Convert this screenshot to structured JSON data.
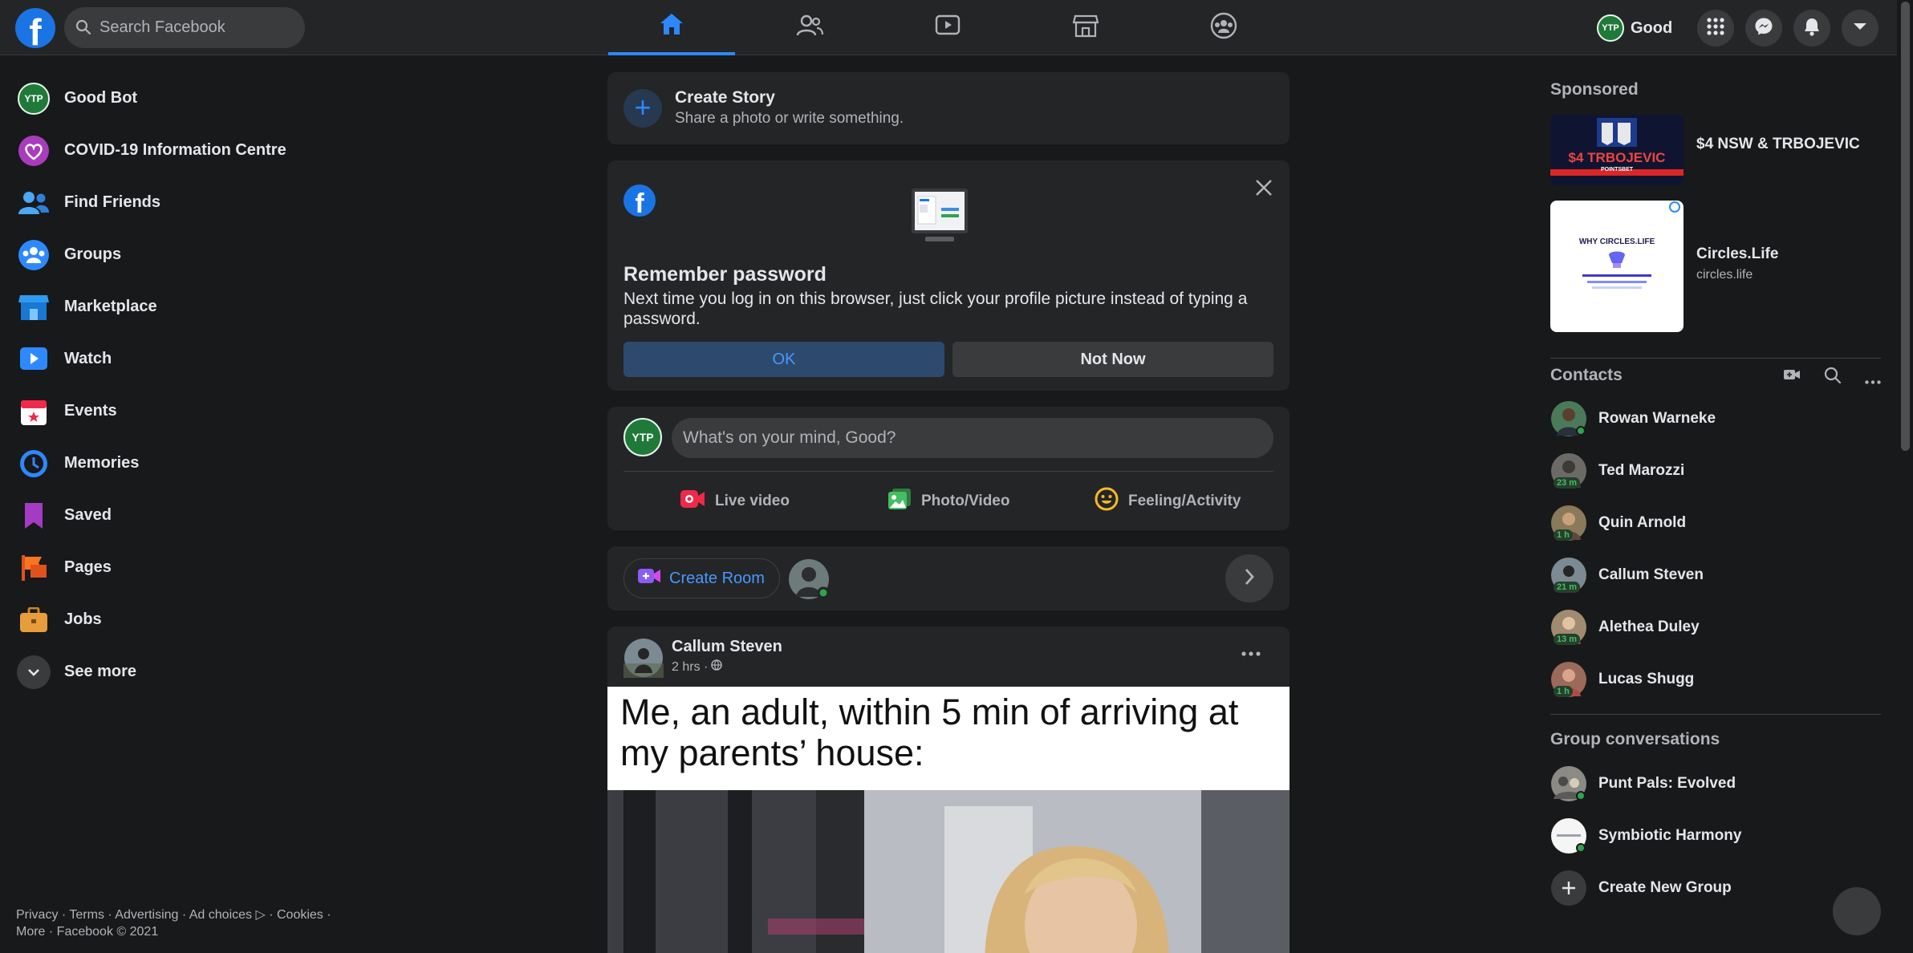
{
  "header": {
    "logo": "f",
    "search_placeholder": "Search Facebook",
    "nav_tabs": [
      {
        "name": "home",
        "icon": "home-icon",
        "active": true
      },
      {
        "name": "friends",
        "icon": "friends-icon",
        "active": false
      },
      {
        "name": "watch",
        "icon": "watch-icon",
        "active": false
      },
      {
        "name": "marketplace",
        "icon": "marketplace-icon",
        "active": false
      },
      {
        "name": "groups",
        "icon": "groups-icon",
        "active": false
      }
    ],
    "profile_badge": "YTP",
    "profile_name": "Good",
    "action_icons": [
      "menu-grid-icon",
      "messenger-icon",
      "notifications-icon",
      "account-dropdown-icon"
    ]
  },
  "sidebar": {
    "items": [
      {
        "label": "Good Bot",
        "icon": "profile-avatar"
      },
      {
        "label": "COVID-19 Information Centre",
        "icon": "covid-heart-icon"
      },
      {
        "label": "Find Friends",
        "icon": "friends-icon"
      },
      {
        "label": "Groups",
        "icon": "groups-icon"
      },
      {
        "label": "Marketplace",
        "icon": "marketplace-icon"
      },
      {
        "label": "Watch",
        "icon": "watch-icon"
      },
      {
        "label": "Events",
        "icon": "calendar-icon"
      },
      {
        "label": "Memories",
        "icon": "clock-icon"
      },
      {
        "label": "Saved",
        "icon": "bookmark-icon"
      },
      {
        "label": "Pages",
        "icon": "flag-icon"
      },
      {
        "label": "Jobs",
        "icon": "briefcase-icon"
      },
      {
        "label": "See more",
        "icon": "chevron-down-icon"
      }
    ],
    "footer_line1": "Privacy · Terms · Advertising · Ad choices ▷ · Cookies ·",
    "footer_line2": "More · Facebook © 2021"
  },
  "feed": {
    "story": {
      "title": "Create Story",
      "subtitle": "Share a photo or write something."
    },
    "remember": {
      "title": "Remember password",
      "body": "Next time you log in on this browser, just click your profile picture instead of typing a password.",
      "ok_label": "OK",
      "not_now_label": "Not Now"
    },
    "composer": {
      "placeholder": "What's on your mind, Good?",
      "actions": [
        "Live video",
        "Photo/Video",
        "Feeling/Activity"
      ]
    },
    "rooms": {
      "create_label": "Create Room"
    },
    "post": {
      "author": "Callum Steven",
      "time": "2 hrs ·",
      "caption": "Me, an adult, within 5 min of arriving at my parents’ house:"
    }
  },
  "right": {
    "sponsored_title": "Sponsored",
    "ads": [
      {
        "title": "$4 NSW & TRBOJEVIC",
        "url": "",
        "image_text": "$4 TRBOJEVIC",
        "image_sub": "POINTSBET"
      },
      {
        "title": "Circles.Life",
        "url": "circles.life",
        "image_text": "WHY CIRCLES.LIFE"
      }
    ],
    "contacts_title": "Contacts",
    "contacts": [
      {
        "name": "Rowan Warneke",
        "status": "online",
        "badge": ""
      },
      {
        "name": "Ted Marozzi",
        "status": "away",
        "badge": "23 m"
      },
      {
        "name": "Quin Arnold",
        "status": "away",
        "badge": "1 h"
      },
      {
        "name": "Callum Steven",
        "status": "away",
        "badge": "21 m"
      },
      {
        "name": "Alethea Duley",
        "status": "away",
        "badge": "13 m"
      },
      {
        "name": "Lucas Shugg",
        "status": "away",
        "badge": "1 h"
      }
    ],
    "group_conversations_title": "Group conversations",
    "groups": [
      {
        "name": "Punt Pals: Evolved"
      },
      {
        "name": "Symbiotic Harmony"
      },
      {
        "name": "Create New Group"
      }
    ]
  },
  "colors": {
    "accent": "#2d88ff",
    "background": "#18191a",
    "surface": "#242526",
    "online": "#31a24c"
  }
}
